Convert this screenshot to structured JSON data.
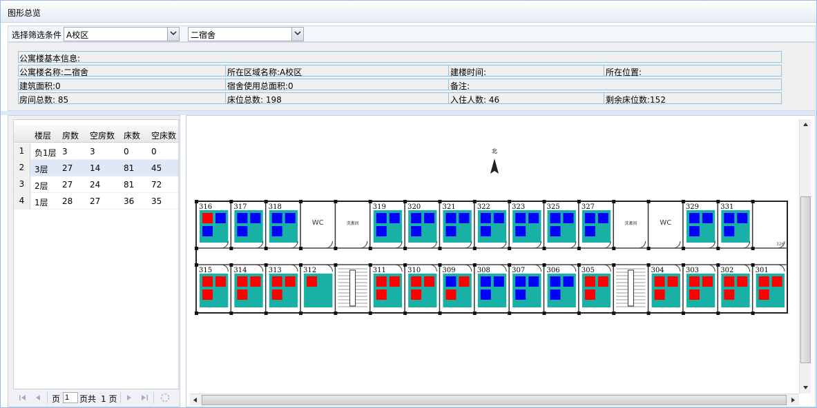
{
  "window": {
    "title": "图形总览"
  },
  "filter": {
    "label": "选择筛选条件",
    "campus_value": "A校区",
    "building_value": "二宿舍"
  },
  "info": {
    "heading": "公寓楼基本信息:",
    "building_name": "公寓楼名称:二宿舍",
    "area_name": "所在区域名称:A校区",
    "build_time": "建楼时间:",
    "location": "所在位置:",
    "floor_area": "建筑面积:0",
    "usage_area": "宿舍使用总面积:0",
    "remark": "备注:",
    "rooms_total": "房间总数: 85",
    "beds_total": "床位总数: 198",
    "occupants": "入住人数: 46",
    "beds_left": "剩余床位数:152"
  },
  "grid": {
    "columns": [
      "楼层",
      "房数",
      "空房数",
      "床数",
      "空床数"
    ],
    "rows": [
      {
        "n": "1",
        "floor": "负1层",
        "rooms": "3",
        "empty_rooms": "3",
        "beds": "0",
        "empty_beds": "0"
      },
      {
        "n": "2",
        "floor": "3层",
        "rooms": "27",
        "empty_rooms": "14",
        "beds": "81",
        "empty_beds": "45"
      },
      {
        "n": "3",
        "floor": "2层",
        "rooms": "27",
        "empty_rooms": "24",
        "beds": "81",
        "empty_beds": "72"
      },
      {
        "n": "4",
        "floor": "1层",
        "rooms": "28",
        "empty_rooms": "27",
        "beds": "36",
        "empty_beds": "35"
      }
    ]
  },
  "pager": {
    "page_label": "页",
    "page_value": "1",
    "total_label": "页共",
    "total_pages": "1 页"
  },
  "colors": {
    "room_fill": "#19b1a6",
    "bed_empty": "#0000ff",
    "bed_occupied": "#ff0000"
  },
  "floorplan": {
    "north_label": "北",
    "top_rooms": [
      {
        "type": "room",
        "label": "316",
        "beds": [
          "occupied",
          "empty",
          "empty"
        ]
      },
      {
        "type": "room",
        "label": "317",
        "beds": [
          "empty",
          "empty",
          "empty"
        ]
      },
      {
        "type": "room",
        "label": "318",
        "beds": [
          "empty",
          "empty",
          "empty"
        ]
      },
      {
        "type": "wc",
        "label": "WC"
      },
      {
        "type": "wash",
        "label": "洗漱间"
      },
      {
        "type": "room",
        "label": "319",
        "beds": [
          "empty",
          "empty",
          "empty"
        ]
      },
      {
        "type": "room",
        "label": "320",
        "beds": [
          "empty",
          "empty",
          "empty"
        ]
      },
      {
        "type": "room",
        "label": "321",
        "beds": [
          "empty",
          "empty",
          "empty"
        ]
      },
      {
        "type": "room",
        "label": "322",
        "beds": [
          "empty",
          "empty",
          "empty"
        ]
      },
      {
        "type": "room",
        "label": "323",
        "beds": [
          "empty",
          "empty",
          "empty"
        ]
      },
      {
        "type": "room",
        "label": "325",
        "beds": [
          "empty",
          "empty",
          "empty"
        ]
      },
      {
        "type": "room",
        "label": "327",
        "beds": [
          "empty",
          "empty",
          "empty"
        ]
      },
      {
        "type": "wash",
        "label": "洗漱间"
      },
      {
        "type": "wc",
        "label": "WC"
      },
      {
        "type": "room",
        "label": "329",
        "beds": [
          "empty",
          "empty",
          "empty"
        ]
      },
      {
        "type": "room",
        "label": "331",
        "beds": [
          "empty",
          "empty",
          "empty"
        ]
      },
      {
        "type": "blank",
        "label": "326"
      }
    ],
    "bottom_rooms": [
      {
        "type": "room",
        "label": "315",
        "beds": [
          "occupied",
          "occupied",
          "occupied"
        ]
      },
      {
        "type": "room",
        "label": "314",
        "beds": [
          "occupied",
          "occupied",
          "occupied"
        ]
      },
      {
        "type": "room",
        "label": "313",
        "beds": [
          "occupied",
          "occupied",
          "occupied"
        ]
      },
      {
        "type": "room",
        "label": "312",
        "beds": [
          "occupied"
        ]
      },
      {
        "type": "stairs",
        "label": ""
      },
      {
        "type": "room",
        "label": "311",
        "beds": [
          "occupied",
          "occupied",
          "occupied"
        ]
      },
      {
        "type": "room",
        "label": "310",
        "beds": [
          "occupied",
          "occupied",
          "occupied"
        ]
      },
      {
        "type": "room",
        "label": "309",
        "beds": [
          "empty",
          "occupied",
          "occupied"
        ]
      },
      {
        "type": "room",
        "label": "308",
        "beds": [
          "empty",
          "empty",
          "empty"
        ]
      },
      {
        "type": "room",
        "label": "307",
        "beds": [
          "empty",
          "empty",
          "empty"
        ]
      },
      {
        "type": "room",
        "label": "306",
        "beds": [
          "empty",
          "empty",
          "empty"
        ]
      },
      {
        "type": "room",
        "label": "305",
        "beds": [
          "occupied",
          "occupied",
          "occupied"
        ]
      },
      {
        "type": "stairs",
        "label": ""
      },
      {
        "type": "room",
        "label": "304",
        "beds": [
          "occupied",
          "occupied",
          "occupied"
        ]
      },
      {
        "type": "room",
        "label": "303",
        "beds": [
          "occupied",
          "occupied",
          "occupied"
        ]
      },
      {
        "type": "room",
        "label": "302",
        "beds": [
          "occupied",
          "occupied",
          "occupied"
        ]
      },
      {
        "type": "room",
        "label": "301",
        "beds": [
          "occupied",
          "occupied",
          "occupied"
        ]
      }
    ]
  }
}
